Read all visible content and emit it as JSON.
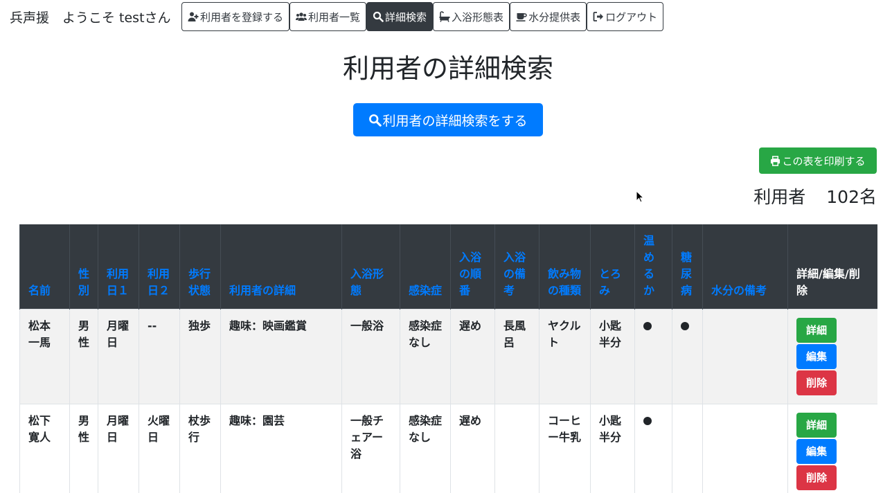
{
  "header": {
    "brand": "兵声援　ようこそ testさん",
    "nav": [
      {
        "label": "利用者を登録する",
        "icon": "user-plus-icon"
      },
      {
        "label": "利用者一覧",
        "icon": "users-icon"
      },
      {
        "label": "詳細検索",
        "icon": "search-icon",
        "active": true
      },
      {
        "label": "入浴形態表",
        "icon": "bath-icon"
      },
      {
        "label": "水分提供表",
        "icon": "coffee-icon"
      },
      {
        "label": "ログアウト",
        "icon": "sign-out-icon"
      }
    ]
  },
  "main": {
    "title": "利用者の詳細検索",
    "search_button": "利用者の詳細検索をする",
    "print_button": "この表を印刷する",
    "count_label": "利用者",
    "count_value": "102名"
  },
  "table": {
    "headers": [
      "名前",
      "性別",
      "利用日１",
      "利用日２",
      "歩行状態",
      "利用者の詳細",
      "入浴形態",
      "感染症",
      "入浴の順番",
      "入浴の備考",
      "飲み物の種類",
      "とろみ",
      "温めるか",
      "糖尿病",
      "水分の備考",
      "詳細/編集/削除"
    ],
    "rows": [
      {
        "name": "松本一馬",
        "gender": "男性",
        "day1": "月曜日",
        "day2": "--",
        "walk": "独歩",
        "detail": "趣味：映画鑑賞",
        "bath": "一般浴",
        "infection": "感染症なし",
        "order": "遅め",
        "bath_note": "長風呂",
        "drink": "ヤクルト",
        "thick": "小匙半分",
        "warm": true,
        "diabetes": true,
        "water_note": ""
      },
      {
        "name": "松下寛人",
        "gender": "男性",
        "day1": "月曜日",
        "day2": "火曜日",
        "walk": "杖歩行",
        "detail": "趣味：園芸",
        "bath": "一般チェアー浴",
        "infection": "感染症なし",
        "order": "遅め",
        "bath_note": "",
        "drink": "コーヒー牛乳",
        "thick": "小匙半分",
        "warm": true,
        "diabetes": false,
        "water_note": ""
      }
    ],
    "actions": {
      "detail": "詳細",
      "edit": "編集",
      "delete": "削除"
    }
  },
  "colors": {
    "primary": "#007bff",
    "success": "#28a745",
    "danger": "#dc3545",
    "dark": "#343a40"
  }
}
